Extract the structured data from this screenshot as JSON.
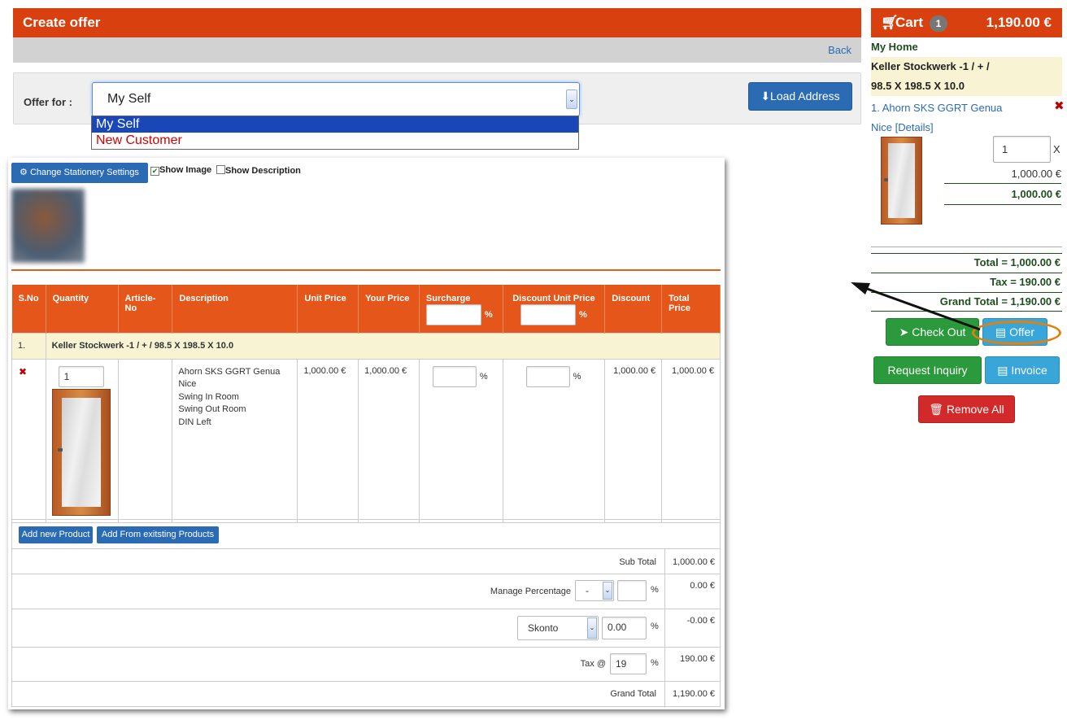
{
  "page": {
    "title": "Create offer",
    "back_label": "Back"
  },
  "offer_for": {
    "label": "Offer for :",
    "selected": "My Self",
    "options": [
      "My Self",
      "New Customer"
    ],
    "load_address_label": "Load Address"
  },
  "document": {
    "stationery_button": "Change Stationery Settings",
    "show_image_label": "Show Image",
    "show_image_checked": true,
    "show_description_label": "Show Description",
    "show_description_checked": false,
    "table_headers": [
      "S.No",
      "Quantity",
      "Article-No",
      "Description",
      "Unit Price",
      "Your Price",
      "Surcharge",
      "Discount Unit Price",
      "Discount",
      "Total Price"
    ],
    "percent_sign": "%",
    "group_row": {
      "sno": "1.",
      "label": "Keller Stockwerk -1 /  +  / 98.5 X 198.5 X 10.0"
    },
    "item": {
      "remove_icon": "✖",
      "quantity": "1",
      "article_no": "",
      "description_lines": [
        "Ahorn SKS GGRT Genua",
        "Nice",
        "Swing In Room",
        "Swing Out Room",
        "DIN Left"
      ],
      "unit_price": "1,000.00 €",
      "your_price": "1,000.00 €",
      "surcharge": "",
      "discount_unit_price": "",
      "discount": "1,000.00 €",
      "total_price": "1,000.00 €"
    },
    "add_new_product": "Add new Product",
    "add_from_existing": "Add From exitsting Products",
    "summary": {
      "sub_total_label": "Sub Total",
      "sub_total_value": "1,000.00 €",
      "manage_percentage_label": "Manage Percentage",
      "manage_percentage_select": "-",
      "manage_percentage_input": "",
      "manage_percentage_value": "0.00 €",
      "skonto_select": "Skonto",
      "skonto_input": "0.00",
      "skonto_value": "-0.00 €",
      "tax_label": "Tax @",
      "tax_input": "19",
      "tax_value": "190.00 €",
      "grand_total_label": "Grand Total",
      "grand_total_value": "1,190.00 €"
    }
  },
  "cart": {
    "title": "Cart",
    "count": "1",
    "total": "1,190.00 €",
    "home_label": "My Home",
    "group_line1": "Keller Stockwerk -1 /  +  /",
    "group_line2": "98.5 X 198.5 X 10.0",
    "article_line1": "1. Ahorn SKS GGRT Genua",
    "article_line2": "Nice [Details]",
    "quantity": "1",
    "times": "X",
    "unit_price": "1,000.00 €",
    "line_total": "1,000.00 €",
    "total_line": "Total = 1,000.00 €",
    "tax_line": "Tax = 190.00 €",
    "grand_total_line": "Grand Total = 1,190.00 €",
    "buttons": {
      "check_out": "Check Out",
      "offer": "Offer",
      "request_inquiry": "Request Inquiry",
      "invoice": "Invoice",
      "remove_all": "Remove All"
    }
  },
  "colors": {
    "header_orange": "#d9400f",
    "table_header_orange": "#e5561a",
    "primary_blue": "#2a6bb3",
    "success_green": "#2a9a3c",
    "info_blue": "#38a6d8",
    "danger_red": "#d22a2a",
    "highlight_oval": "#e08010"
  }
}
